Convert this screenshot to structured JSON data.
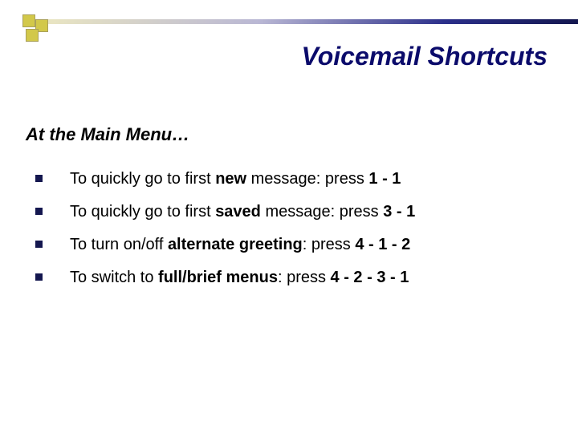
{
  "title": "Voicemail Shortcuts",
  "subtitle": "At the Main Menu…",
  "bullets": [
    {
      "pre": "To quickly go to first ",
      "bold1": "new",
      "mid": " message:  press ",
      "bold2": "1 - 1"
    },
    {
      "pre": "To quickly go to first ",
      "bold1": "saved",
      "mid": " message:  press ",
      "bold2": "3 - 1"
    },
    {
      "pre": "To turn on/off ",
      "bold1": "alternate greeting",
      "mid": ":  press ",
      "bold2": "4 - 1 - 2"
    },
    {
      "pre": "To switch to ",
      "bold1": "full/brief menus",
      "mid": ":  press ",
      "bold2": "4 - 2 - 3 - 1"
    }
  ]
}
